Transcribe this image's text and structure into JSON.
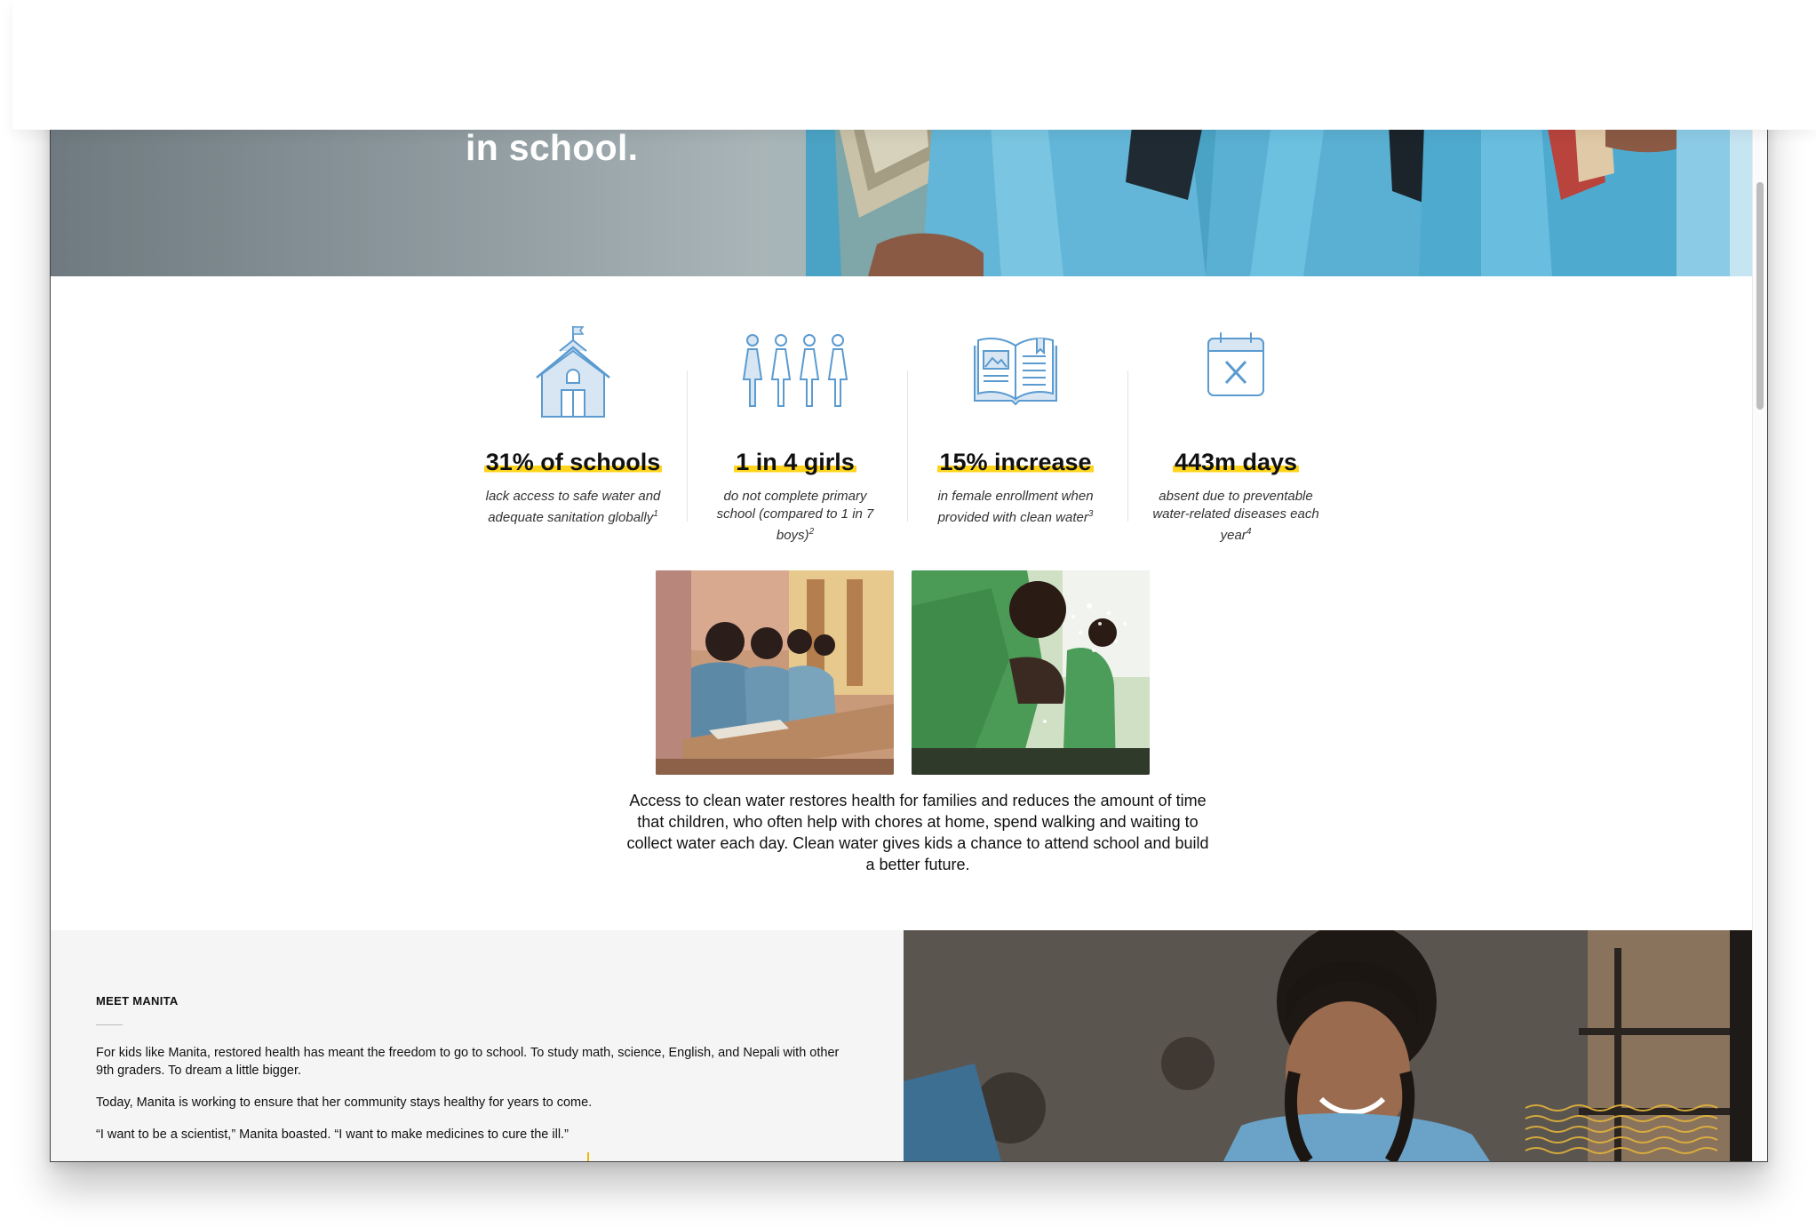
{
  "hero": {
    "title": "in school."
  },
  "stats": [
    {
      "icon": "schoolhouse-icon",
      "headline": "31% of schools",
      "description": "lack access to safe water and adequate sanitation globally",
      "footnote": "1"
    },
    {
      "icon": "four-girls-icon",
      "headline": "1 in 4 girls",
      "description": "do not complete primary school (compared to 1 in 7 boys)",
      "footnote": "2"
    },
    {
      "icon": "open-book-icon",
      "headline": "15% increase",
      "description": "in female enrollment when provided with clean water",
      "footnote": "3"
    },
    {
      "icon": "calendar-x-icon",
      "headline": "443m days",
      "description": "absent due to preventable water-related diseases each year",
      "footnote": "4"
    }
  ],
  "photos": [
    "classroom-girls-photo",
    "boy-washing-hands-photo"
  ],
  "caption": "Access to clean water restores health for families and reduces the amount of time that children, who often help with chores at home, spend walking and waiting to collect water each day. Clean water gives kids a chance to attend school and build a better future.",
  "meet": {
    "eyebrow": "MEET MANITA",
    "paragraphs": [
      "For kids like Manita, restored health has meant the freedom to go to school. To study math, science, English, and Nepali with other 9th graders. To dream a little bigger.",
      "Today, Manita is working to ensure that her community stays healthy for years to come.",
      "“I want to be a scientist,” Manita boasted. “I want to make medicines to cure the ill.”"
    ]
  },
  "colors": {
    "accent": "#ffd41c",
    "icon_blue": "#5b9bd0",
    "icon_fill": "#d8e6f3",
    "section_gray": "#f5f5f5"
  }
}
